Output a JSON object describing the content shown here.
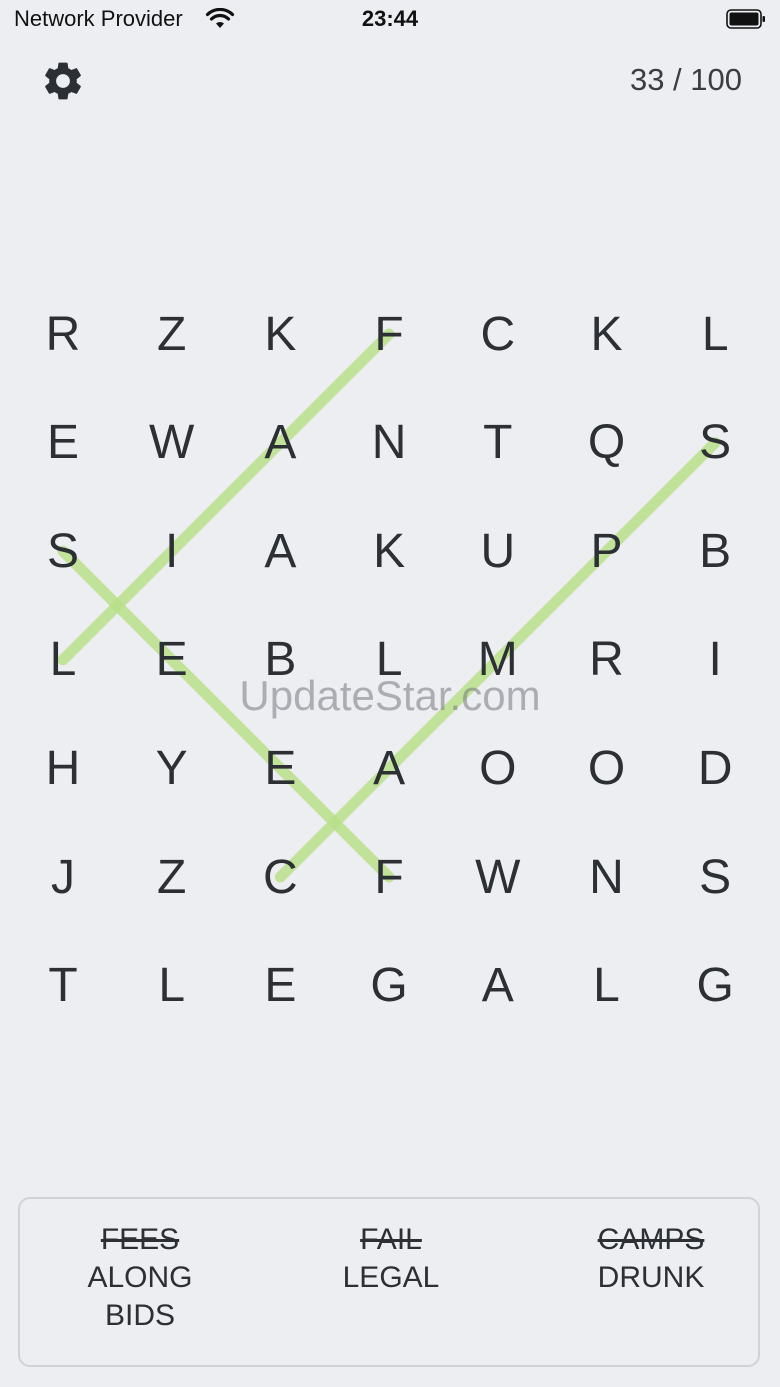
{
  "status": {
    "carrier": "Network Provider",
    "time": "23:44"
  },
  "header": {
    "progress": "33 / 100"
  },
  "grid": [
    [
      "R",
      "Z",
      "K",
      "F",
      "C",
      "K",
      "L"
    ],
    [
      "E",
      "W",
      "A",
      "N",
      "T",
      "Q",
      "S"
    ],
    [
      "S",
      "I",
      "A",
      "K",
      "U",
      "P",
      "B"
    ],
    [
      "L",
      "E",
      "B",
      "L",
      "M",
      "R",
      "I"
    ],
    [
      "H",
      "Y",
      "E",
      "A",
      "O",
      "O",
      "D"
    ],
    [
      "J",
      "Z",
      "C",
      "F",
      "W",
      "N",
      "S"
    ],
    [
      "T",
      "L",
      "E",
      "G",
      "A",
      "L",
      "G"
    ]
  ],
  "found_lines": [
    {
      "word": "FAIL",
      "start": [
        0,
        3
      ],
      "end": [
        3,
        0
      ]
    },
    {
      "word": "SEEF",
      "start": [
        2,
        0
      ],
      "end": [
        5,
        3
      ]
    },
    {
      "word": "SPMAC",
      "start": [
        1,
        6
      ],
      "end": [
        5,
        2
      ]
    }
  ],
  "colors": {
    "highlight": "#b9e08a",
    "text": "#2c2f33",
    "background": "#eceef2"
  },
  "watermark": "UpdateStar.com",
  "words": {
    "col1": [
      {
        "text": "FEES",
        "found": true
      },
      {
        "text": "ALONG",
        "found": false
      },
      {
        "text": "BIDS",
        "found": false
      }
    ],
    "col2": [
      {
        "text": "FAIL",
        "found": true
      },
      {
        "text": "LEGAL",
        "found": false
      }
    ],
    "col3": [
      {
        "text": "CAMPS",
        "found": true
      },
      {
        "text": "DRUNK",
        "found": false
      }
    ]
  }
}
